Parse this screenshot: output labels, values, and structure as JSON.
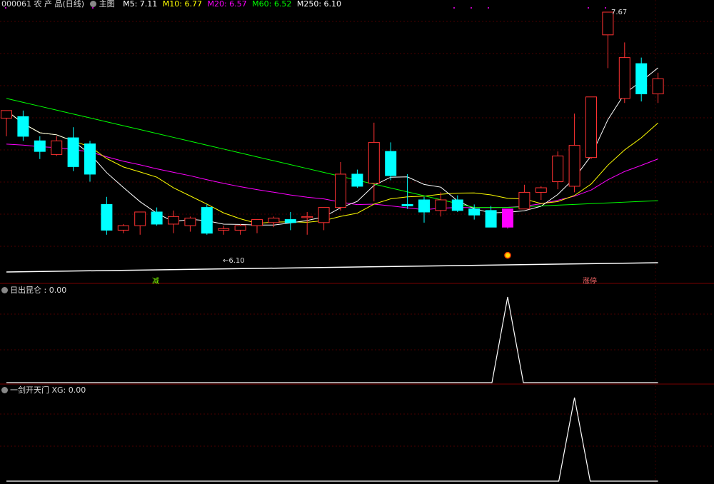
{
  "header": {
    "code_name": "000061 农 产 品(日线)",
    "main_label": "主图",
    "indicators": [
      {
        "label": "M5: 7.11",
        "color": "#ffffff"
      },
      {
        "label": "M10: 6.77",
        "color": "#ffff00"
      },
      {
        "label": "M20: 6.57",
        "color": "#ff00ff"
      },
      {
        "label": "M60: 6.52",
        "color": "#00ff00"
      },
      {
        "label": "M250: 6.10",
        "color": "#ffffff"
      }
    ]
  },
  "panel2": {
    "label": "日出昆仑 : 0.00"
  },
  "panel3": {
    "label": "一剑开天门 XG: 0.00"
  },
  "markers": {
    "low_label": "←6.10",
    "high_label": "7.67",
    "tag_left": "减",
    "tag_right": "涨停"
  },
  "colors": {
    "up": "#ff3232",
    "down": "#00ffff",
    "special": "#ff00ff",
    "grid": "#4a0000",
    "signal": "#ffffff"
  },
  "chart_data": {
    "type": "candlestick",
    "price_range": [
      6.0,
      7.7
    ],
    "candles": [
      {
        "o": 6.97,
        "h": 7.02,
        "l": 6.85,
        "c": 7.02
      },
      {
        "o": 6.98,
        "h": 7.02,
        "l": 6.82,
        "c": 6.85
      },
      {
        "o": 6.82,
        "h": 6.85,
        "l": 6.7,
        "c": 6.75
      },
      {
        "o": 6.73,
        "h": 6.85,
        "l": 6.72,
        "c": 6.82
      },
      {
        "o": 6.84,
        "h": 6.91,
        "l": 6.62,
        "c": 6.65
      },
      {
        "o": 6.8,
        "h": 6.82,
        "l": 6.55,
        "c": 6.6
      },
      {
        "o": 6.4,
        "h": 6.45,
        "l": 6.2,
        "c": 6.23
      },
      {
        "o": 6.23,
        "h": 6.27,
        "l": 6.21,
        "c": 6.26
      },
      {
        "o": 6.26,
        "h": 6.35,
        "l": 6.2,
        "c": 6.35
      },
      {
        "o": 6.35,
        "h": 6.38,
        "l": 6.26,
        "c": 6.27
      },
      {
        "o": 6.27,
        "h": 6.36,
        "l": 6.21,
        "c": 6.32
      },
      {
        "o": 6.26,
        "h": 6.32,
        "l": 6.22,
        "c": 6.31
      },
      {
        "o": 6.38,
        "h": 6.4,
        "l": 6.2,
        "c": 6.21
      },
      {
        "o": 6.23,
        "h": 6.26,
        "l": 6.2,
        "c": 6.24
      },
      {
        "o": 6.23,
        "h": 6.27,
        "l": 6.2,
        "c": 6.26
      },
      {
        "o": 6.26,
        "h": 6.3,
        "l": 6.21,
        "c": 6.3
      },
      {
        "o": 6.28,
        "h": 6.32,
        "l": 6.25,
        "c": 6.31
      },
      {
        "o": 6.3,
        "h": 6.35,
        "l": 6.23,
        "c": 6.28
      },
      {
        "o": 6.32,
        "h": 6.35,
        "l": 6.2,
        "c": 6.32
      },
      {
        "o": 6.28,
        "h": 6.38,
        "l": 6.23,
        "c": 6.38
      },
      {
        "o": 6.38,
        "h": 6.68,
        "l": 6.36,
        "c": 6.6
      },
      {
        "o": 6.6,
        "h": 6.63,
        "l": 6.51,
        "c": 6.52
      },
      {
        "o": 6.54,
        "h": 6.94,
        "l": 6.42,
        "c": 6.81
      },
      {
        "o": 6.75,
        "h": 6.81,
        "l": 6.56,
        "c": 6.59
      },
      {
        "o": 6.4,
        "h": 6.6,
        "l": 6.37,
        "c": 6.39
      },
      {
        "o": 6.43,
        "h": 6.45,
        "l": 6.28,
        "c": 6.35
      },
      {
        "o": 6.36,
        "h": 6.48,
        "l": 6.32,
        "c": 6.43
      },
      {
        "o": 6.43,
        "h": 6.46,
        "l": 6.35,
        "c": 6.36
      },
      {
        "o": 6.37,
        "h": 6.4,
        "l": 6.3,
        "c": 6.33
      },
      {
        "o": 6.36,
        "h": 6.39,
        "l": 6.26,
        "c": 6.25
      },
      {
        "o": 6.25,
        "h": 6.37,
        "l": 6.24,
        "c": 6.37
      },
      {
        "o": 6.37,
        "h": 6.53,
        "l": 6.37,
        "c": 6.48
      },
      {
        "o": 6.48,
        "h": 6.52,
        "l": 6.43,
        "c": 6.51
      },
      {
        "o": 6.55,
        "h": 6.75,
        "l": 6.5,
        "c": 6.72
      },
      {
        "o": 6.52,
        "h": 7.0,
        "l": 6.48,
        "c": 6.79
      },
      {
        "o": 6.71,
        "h": 7.11,
        "l": 6.7,
        "c": 7.11
      },
      {
        "o": 7.52,
        "h": 7.67,
        "l": 7.3,
        "c": 7.67
      },
      {
        "o": 7.1,
        "h": 7.47,
        "l": 7.07,
        "c": 7.37
      },
      {
        "o": 7.33,
        "h": 7.37,
        "l": 7.08,
        "c": 7.13
      },
      {
        "o": 7.13,
        "h": 7.27,
        "l": 7.07,
        "c": 7.23
      }
    ],
    "lower_series": [
      {
        "name": "日出昆仑",
        "peak_index": 30,
        "peak_value": 1
      },
      {
        "name": "一剑开天门 XG",
        "peak_index": 34,
        "peak_value": 1
      }
    ]
  }
}
